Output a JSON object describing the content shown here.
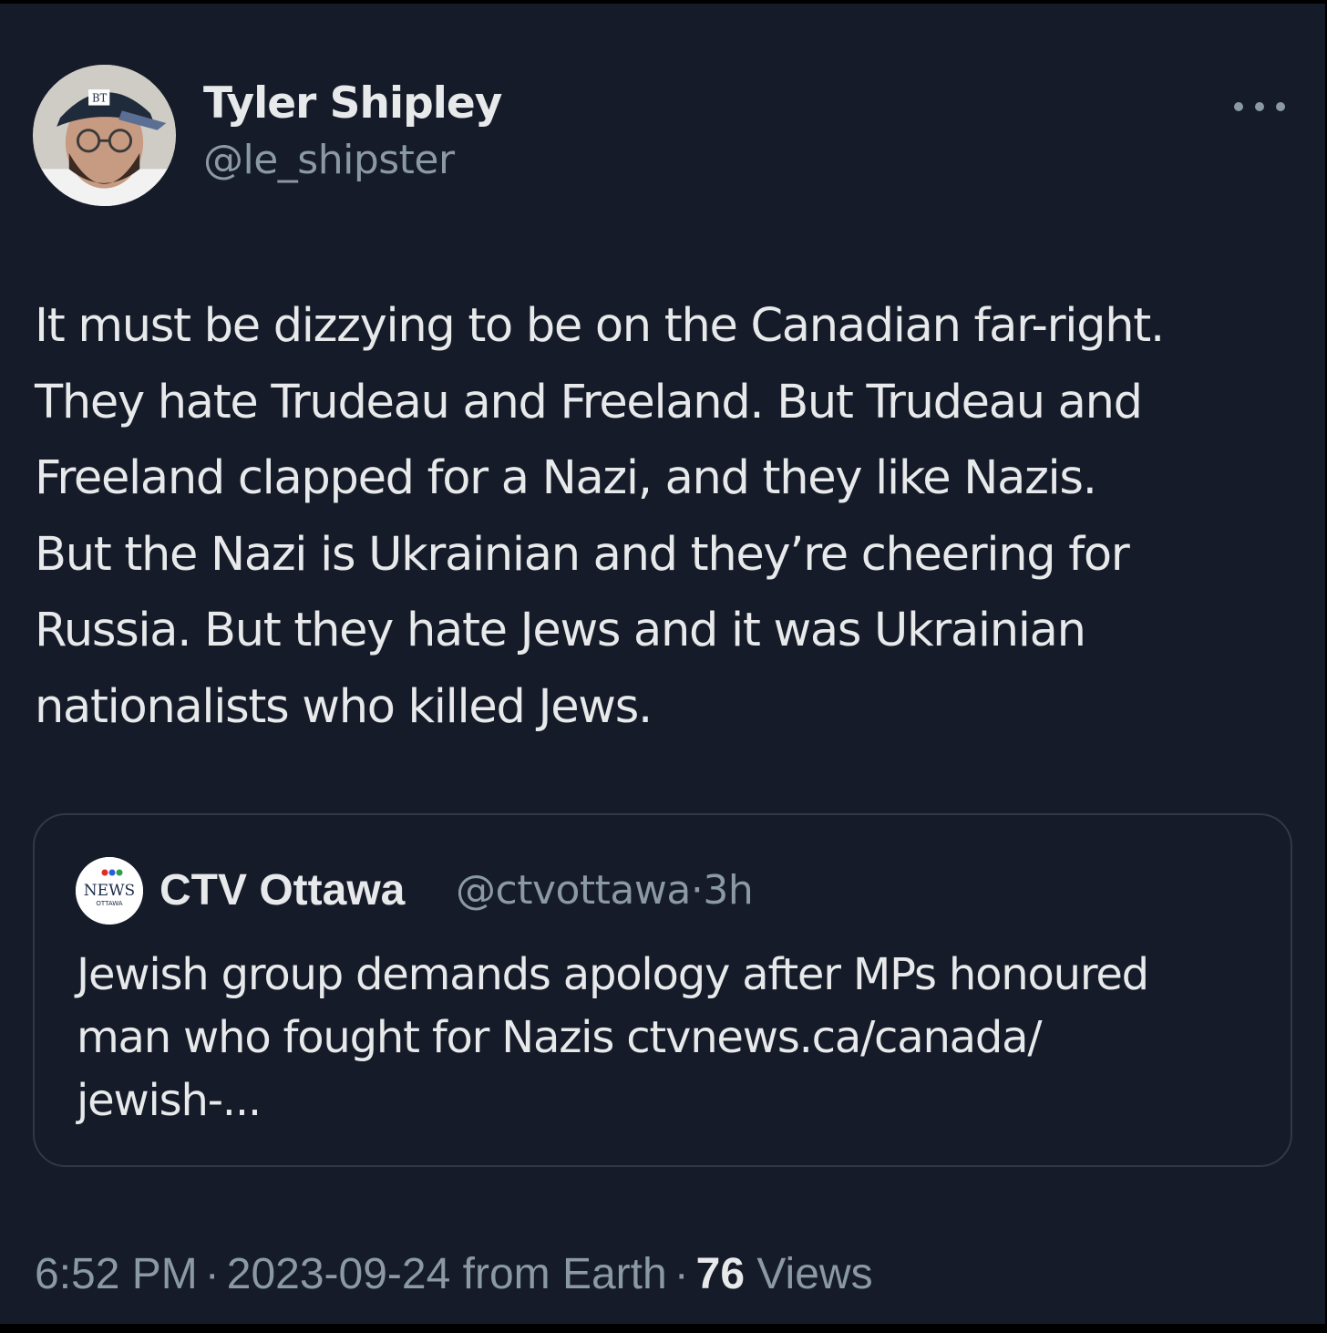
{
  "author": {
    "display_name": "Tyler Shipley",
    "handle": "@le_shipster",
    "avatar_icon": "profile-photo"
  },
  "more_icon": "more-dots-icon",
  "tweet": {
    "text": "It must be dizzying to be on the Canadian far-right.\nThey hate Trudeau and Freeland. But Trudeau and\nFreeland clapped for a Nazi, and they like Nazis.\nBut the Nazi is Ukrainian and they’re cheering for\nRussia. But they hate Jews and it was Ukrainian\nnationalists who killed Jews."
  },
  "quoted_tweet": {
    "display_name": "CTV Ottawa",
    "handle": "@ctvottawa",
    "separator": "·",
    "age": "3h",
    "avatar_icon": "ctv-news-ottawa-logo",
    "text": "Jewish group demands apology after MPs honoured\nman who fought for Nazis ctvnews.ca/canada/\njewish-..."
  },
  "footer": {
    "time": "6:52 PM",
    "separator": "·",
    "date": "2023-09-24",
    "source": "from Earth",
    "views_count": "76",
    "views_label": "Views"
  },
  "colors": {
    "background": "#151b28",
    "primary_text": "#e7e9ea",
    "secondary_text": "#8b98a5",
    "border": "#2f3947"
  }
}
